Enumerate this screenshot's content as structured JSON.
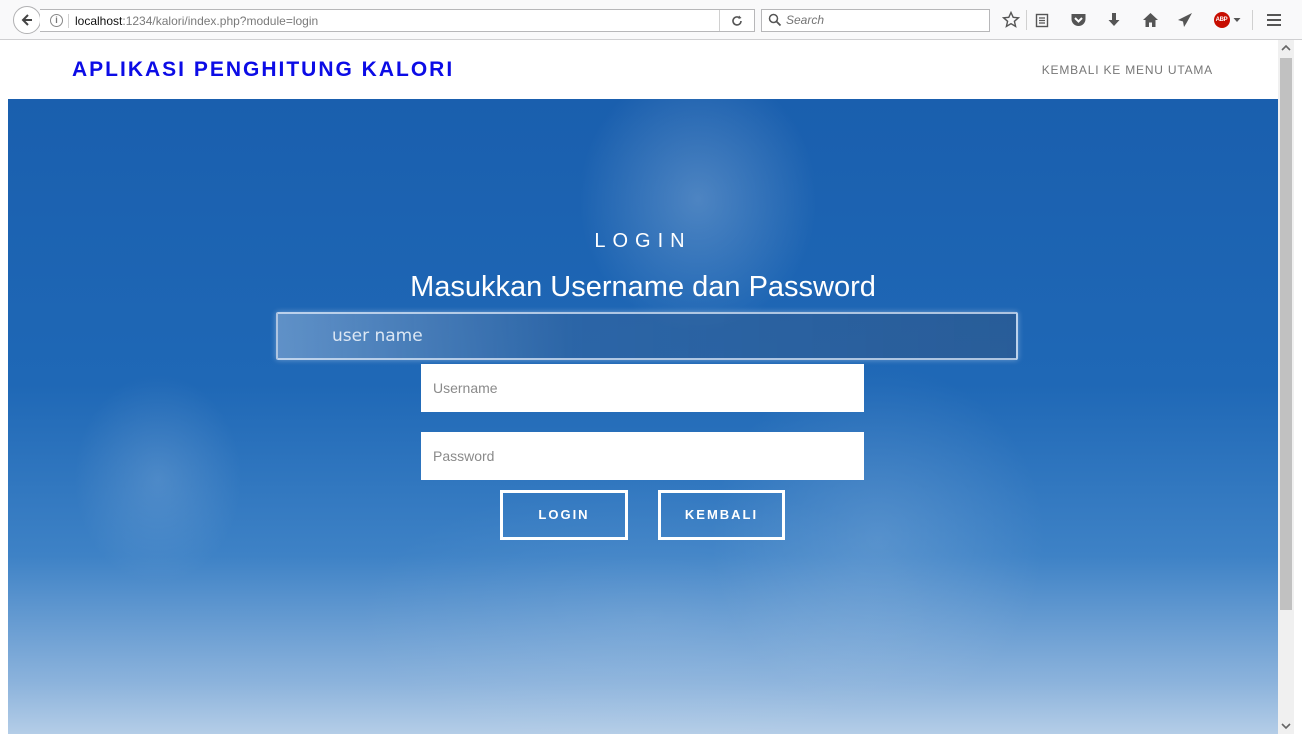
{
  "browser": {
    "url_host": "localhost",
    "url_path": ":1234/kalori/index.php?module=login",
    "search_placeholder": "Search",
    "adblock_label": "ABP"
  },
  "navbar": {
    "brand": "APLIKASI PENGHITUNG KALORI",
    "link": "KEMBALI KE MENU UTAMA"
  },
  "hero": {
    "background_label": "user name"
  },
  "login": {
    "title": "LOGIN",
    "subtitle": "Masukkan Username dan Password",
    "username_placeholder": "Username",
    "password_placeholder": "Password",
    "login_button": "LOGIN",
    "back_button": "KEMBALI"
  },
  "colors": {
    "brand": "#0c0ce6",
    "hero_blue": "#1f68b6"
  }
}
